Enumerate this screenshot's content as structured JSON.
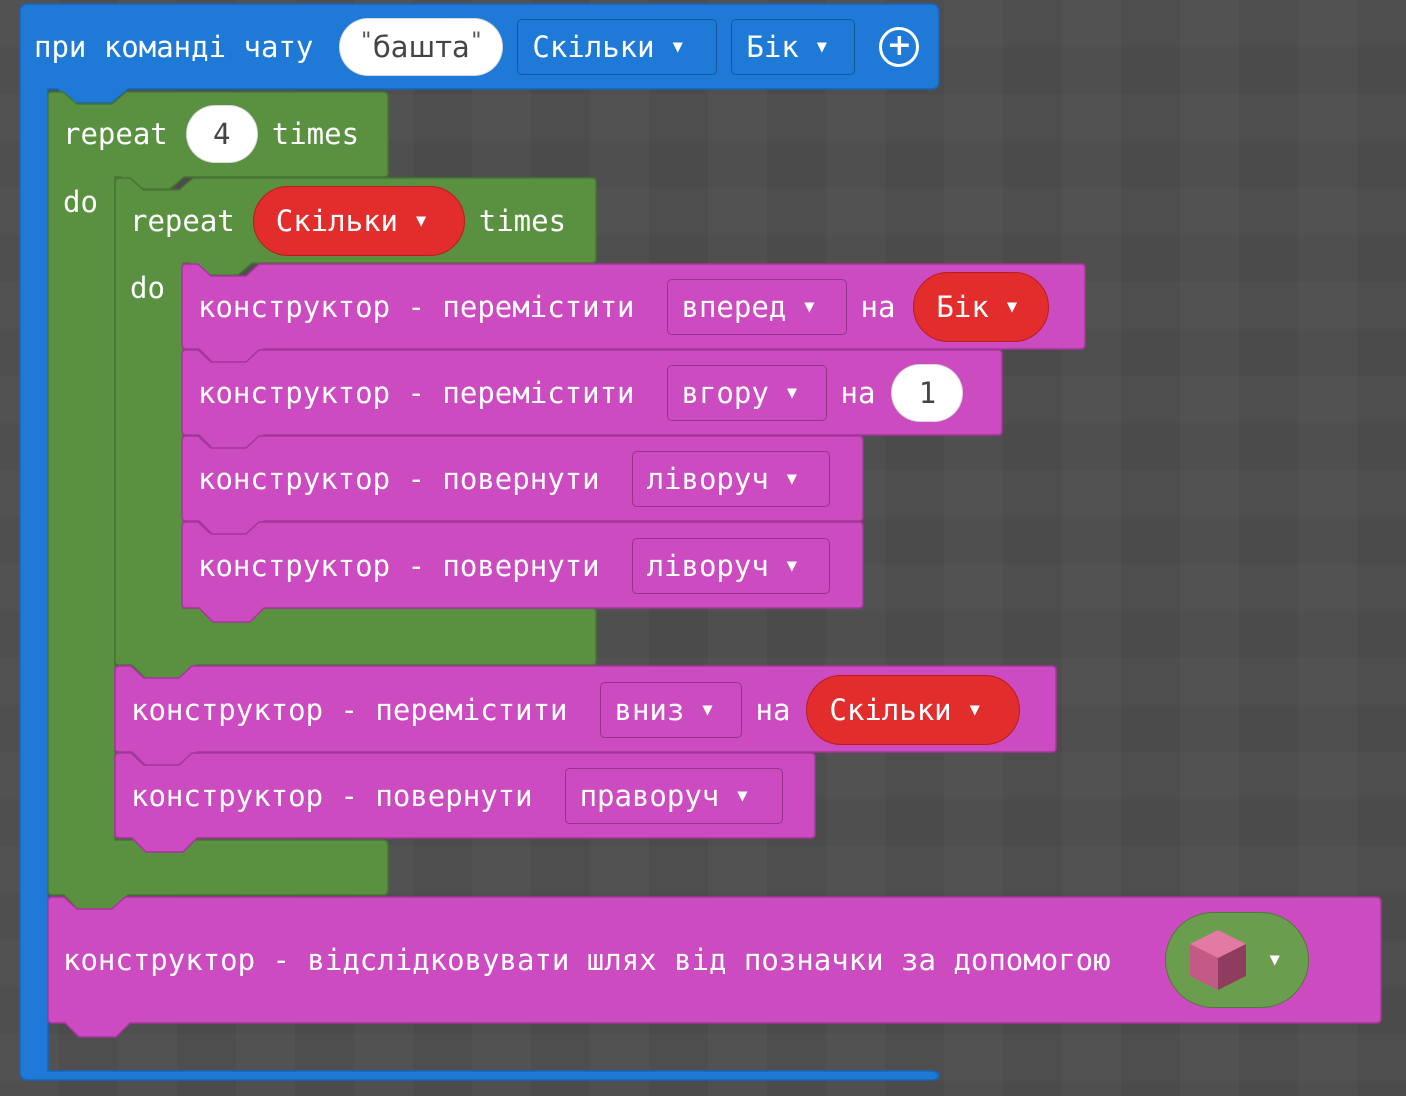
{
  "colors": {
    "event_block": "#1e7ad6",
    "loop_block": "#5a9140",
    "builder_block": "#cc4bc0",
    "variable": "#e32c2c"
  },
  "event": {
    "label": "при команді чату",
    "command_open_quote": "\"",
    "command": "башта",
    "command_close_quote": "\"",
    "param1": "Скільки",
    "param2": "Бік",
    "add_icon": "plus-circle-icon"
  },
  "loop_outer": {
    "repeat_label": "repeat",
    "count": "4",
    "times_label": "times",
    "do_label": "do"
  },
  "loop_inner": {
    "repeat_label": "repeat",
    "count_var": "Скільки",
    "times_label": "times",
    "do_label": "do"
  },
  "inner_blocks": [
    {
      "prefix": "конструктор - перемістити",
      "option": "вперед",
      "on_label": "на",
      "value": "Бік"
    },
    {
      "prefix": "конструктор - перемістити",
      "option": "вгору",
      "on_label": "на",
      "value": "1"
    },
    {
      "prefix": "конструктор - повернути",
      "option": "ліворуч"
    },
    {
      "prefix": "конструктор - повернути",
      "option": "ліворуч"
    }
  ],
  "outer_blocks": [
    {
      "prefix": "конструктор - перемістити",
      "option": "вниз",
      "on_label": "на",
      "value": "Скільки"
    },
    {
      "prefix": "конструктор - повернути",
      "option": "праворуч"
    }
  ],
  "trace_block": {
    "label": "конструктор - відслідковувати шлях від позначки за допомогою",
    "block_icon": "pink-cube-icon"
  },
  "icons": {
    "dropdown": "▼",
    "plus": "+"
  }
}
